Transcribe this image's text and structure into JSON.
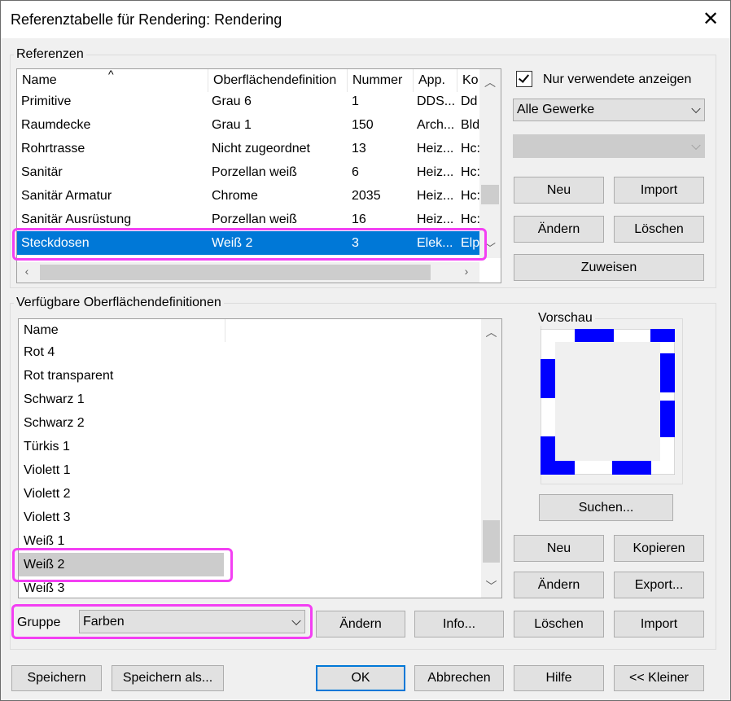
{
  "window": {
    "title": "Referenztabelle für Rendering: Rendering",
    "close_label": "✕"
  },
  "refs": {
    "title": "Referenzen",
    "headers": [
      "Name",
      "Oberflächendefinition",
      "Nummer",
      "App.",
      "Ko"
    ],
    "rows": [
      [
        "Primitive",
        "Grau 6",
        "1",
        "DDS...",
        "Dd"
      ],
      [
        "Raumdecke",
        "Grau 1",
        "150",
        "Arch...",
        "Bld"
      ],
      [
        "Rohrtrasse",
        "Nicht zugeordnet",
        "13",
        "Heiz...",
        "Hc:"
      ],
      [
        "Sanitär",
        "Porzellan weiß",
        "6",
        "Heiz...",
        "Hc:"
      ],
      [
        "Sanitär Armatur",
        "Chrome",
        "2035",
        "Heiz...",
        "Hc:"
      ],
      [
        "Sanitär Ausrüstung",
        "Porzellan weiß",
        "16",
        "Heiz...",
        "Hc:"
      ],
      [
        "Steckdosen",
        "Weiß 2",
        "3",
        "Elek...",
        "Elp"
      ]
    ],
    "selected_index": 6,
    "show_used_label": "Nur verwendete anzeigen",
    "show_used_checked": true,
    "trade_value": "Alle Gewerke",
    "second_value": "",
    "btn_neu": "Neu",
    "btn_import": "Import",
    "btn_aendern": "Ändern",
    "btn_loeschen": "Löschen",
    "btn_zuweisen": "Zuweisen"
  },
  "defs": {
    "title": "Verfügbare Oberflächendefinitionen",
    "header": "Name",
    "rows": [
      "Rot 4",
      "Rot transparent",
      "Schwarz 1",
      "Schwarz 2",
      "Türkis 1",
      "Violett 1",
      "Violett 2",
      "Violett 3",
      "Weiß 1",
      "Weiß 2",
      "Weiß 3"
    ],
    "selected_index": 9,
    "preview_title": "Vorschau",
    "btn_suchen": "Suchen...",
    "btn_neu": "Neu",
    "btn_kopieren": "Kopieren",
    "btn_aendern": "Ändern",
    "btn_export": "Export...",
    "group_label": "Gruppe",
    "group_value": "Farben",
    "btn_group_aendern": "Ändern",
    "btn_info": "Info...",
    "btn_loeschen": "Löschen",
    "btn_import": "Import"
  },
  "footer": {
    "save": "Speichern",
    "save_as": "Speichern als...",
    "ok": "OK",
    "cancel": "Abbrechen",
    "help": "Hilfe",
    "smaller": "<< Kleiner"
  },
  "colors": {
    "selection": "#0078d7",
    "highlight": "#f33ff3",
    "preview_blue": "#0000ff"
  }
}
